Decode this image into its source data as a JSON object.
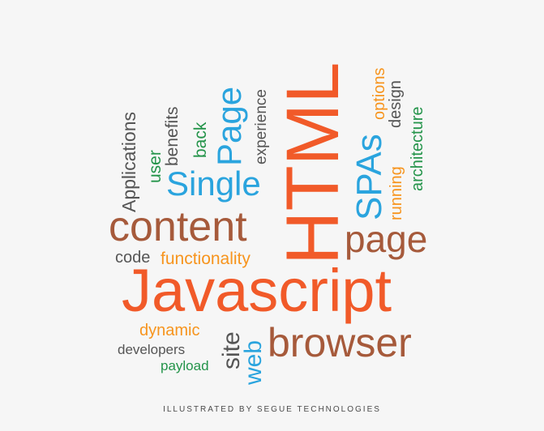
{
  "colors": {
    "orange_red": "#f15a29",
    "brown": "#a65a3b",
    "blue": "#2aa4de",
    "green": "#24944a",
    "orange": "#f7941d",
    "gray": "#555555",
    "background": "#f6f6f6"
  },
  "words": {
    "html": "HTML",
    "javascript": "Javascript",
    "content": "content",
    "page": "page",
    "browser": "browser",
    "single": "Single",
    "page_vertical": "Page",
    "spas": "SPAs",
    "applications": "Applications",
    "user": "user",
    "benefits": "benefits",
    "back": "back",
    "experience": "experience",
    "options": "options",
    "design": "design",
    "architecture": "architecture",
    "running": "running",
    "code": "code",
    "functionality": "functionality",
    "dynamic": "dynamic",
    "developers": "developers",
    "payload": "payload",
    "site": "site",
    "web": "web"
  },
  "credit": "ILLUSTRATED BY SEGUE TECHNOLOGIES"
}
